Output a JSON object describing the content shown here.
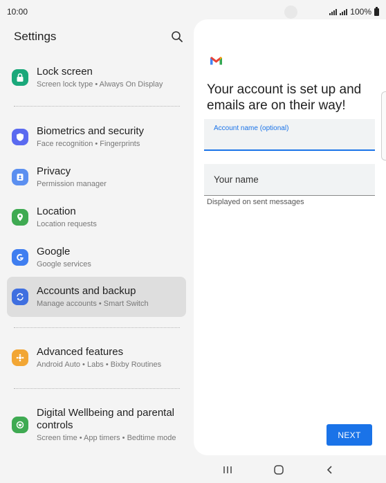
{
  "status_bar": {
    "time": "10:00",
    "battery": "100%",
    "icons": [
      "signal-icon",
      "signal-icon",
      "battery-icon"
    ]
  },
  "settings": {
    "title": "Settings",
    "search_icon": "search-icon",
    "items": [
      {
        "title": "Lock screen",
        "subtitle": "Screen lock type  •  Always On Display",
        "icon": "lock-icon",
        "color": "#1aa87a"
      },
      {
        "title": "Biometrics and security",
        "subtitle": "Face recognition  •  Fingerprints",
        "icon": "shield-icon",
        "color": "#5a6af0"
      },
      {
        "title": "Privacy",
        "subtitle": "Permission manager",
        "icon": "privacy-icon",
        "color": "#5b8ff0"
      },
      {
        "title": "Location",
        "subtitle": "Location requests",
        "icon": "location-pin-icon",
        "color": "#3faa52"
      },
      {
        "title": "Google",
        "subtitle": "Google services",
        "icon": "google-icon",
        "color": "#3f7ef0"
      },
      {
        "title": "Accounts and backup",
        "subtitle": "Manage accounts  •  Smart Switch",
        "icon": "sync-icon",
        "color": "#3f6fe0"
      },
      {
        "title": "Advanced features",
        "subtitle": "Android Auto  •  Labs  •  Bixby Routines",
        "icon": "puzzle-icon",
        "color": "#f2a634"
      },
      {
        "title": "Digital Wellbeing and parental controls",
        "subtitle": "Screen time  •  App timers  •  Bedtime mode",
        "icon": "wellbeing-icon",
        "color": "#3faa52"
      }
    ],
    "selected_index": 5
  },
  "panel": {
    "logo_icon": "gmail-icon",
    "heading": "Your account is set up and emails are on their way!",
    "account_field_label": "Account name (optional)",
    "account_field_value": "",
    "name_field_placeholder": "Your name",
    "helper_text": "Displayed on sent messages",
    "next_label": "NEXT",
    "accent_color": "#1a73e8"
  },
  "nav": {
    "recent_icon": "recent-apps-icon",
    "home_icon": "home-icon",
    "back_icon": "back-icon"
  }
}
